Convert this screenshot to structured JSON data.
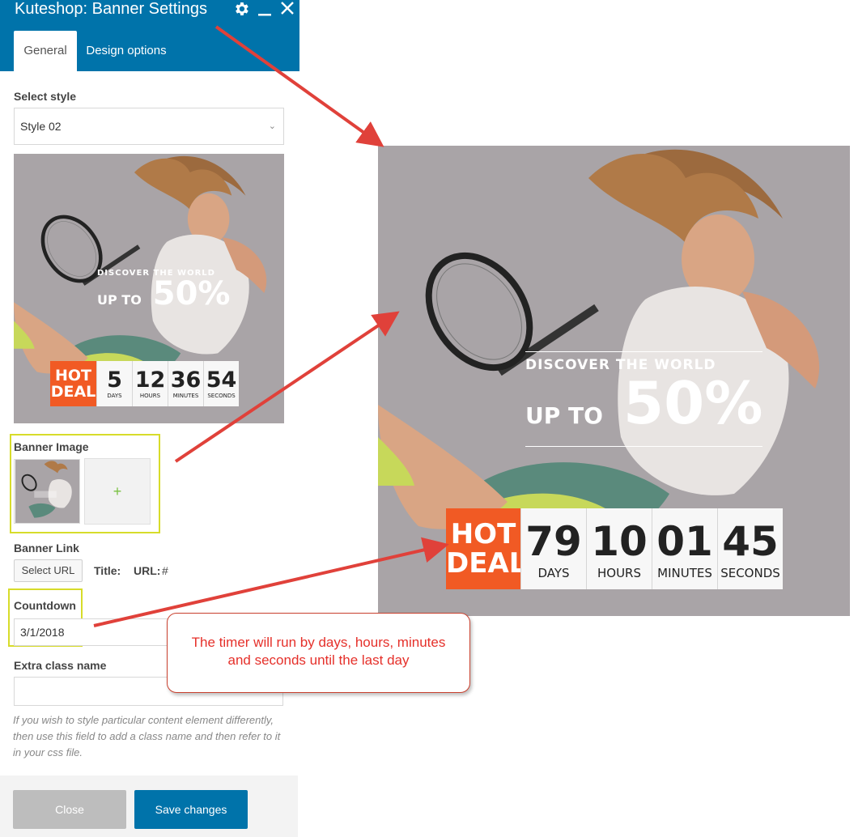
{
  "window": {
    "title": "Kuteshop: Banner Settings",
    "icons": [
      "gear-icon",
      "minimize-icon",
      "close-icon"
    ]
  },
  "tabs": [
    {
      "label": "General",
      "active": true
    },
    {
      "label": "Design options",
      "active": false
    }
  ],
  "style_field": {
    "label": "Select style",
    "value": "Style 02"
  },
  "banner_image_field": {
    "label": "Banner Image",
    "add_icon": "+"
  },
  "banner_link_field": {
    "label": "Banner Link",
    "button": "Select URL",
    "title_label": "Title:",
    "url_label": "URL:",
    "url_value": "#"
  },
  "countdown_field": {
    "label": "Countdown",
    "value": "3/1/2018"
  },
  "extra_class_field": {
    "label": "Extra class name",
    "value": "",
    "help": "If you wish to style particular content element differently, then use this field to add a class name and then refer to it in your css file."
  },
  "footer": {
    "close_label": "Close",
    "save_label": "Save changes"
  },
  "preview_banner": {
    "headline": "DISCOVER THE WORLD",
    "offer_prefix": "UP TO",
    "offer_value": "50%",
    "hot_deal": "HOT DEAL",
    "countdown": [
      {
        "value": "5",
        "unit": "DAYS"
      },
      {
        "value": "12",
        "unit": "HOURS"
      },
      {
        "value": "36",
        "unit": "MINUTES"
      },
      {
        "value": "54",
        "unit": "SECONDS"
      }
    ]
  },
  "result_banner": {
    "headline": "DISCOVER THE WORLD",
    "offer_prefix": "UP TO",
    "offer_value": "50%",
    "hot_deal": "HOT DEAL",
    "countdown": [
      {
        "value": "79",
        "unit": "DAYS"
      },
      {
        "value": "10",
        "unit": "HOURS"
      },
      {
        "value": "01",
        "unit": "MINUTES"
      },
      {
        "value": "45",
        "unit": "SECONDS"
      }
    ]
  },
  "annotation": {
    "callout_text": "The timer will  run by days, hours, minutes and seconds until the last day"
  },
  "colors": {
    "header_blue": "#0073aa",
    "hot_deal_orange": "#f15a24",
    "highlight_yellow": "#d7dc2a",
    "arrow_red": "#e0413a"
  }
}
